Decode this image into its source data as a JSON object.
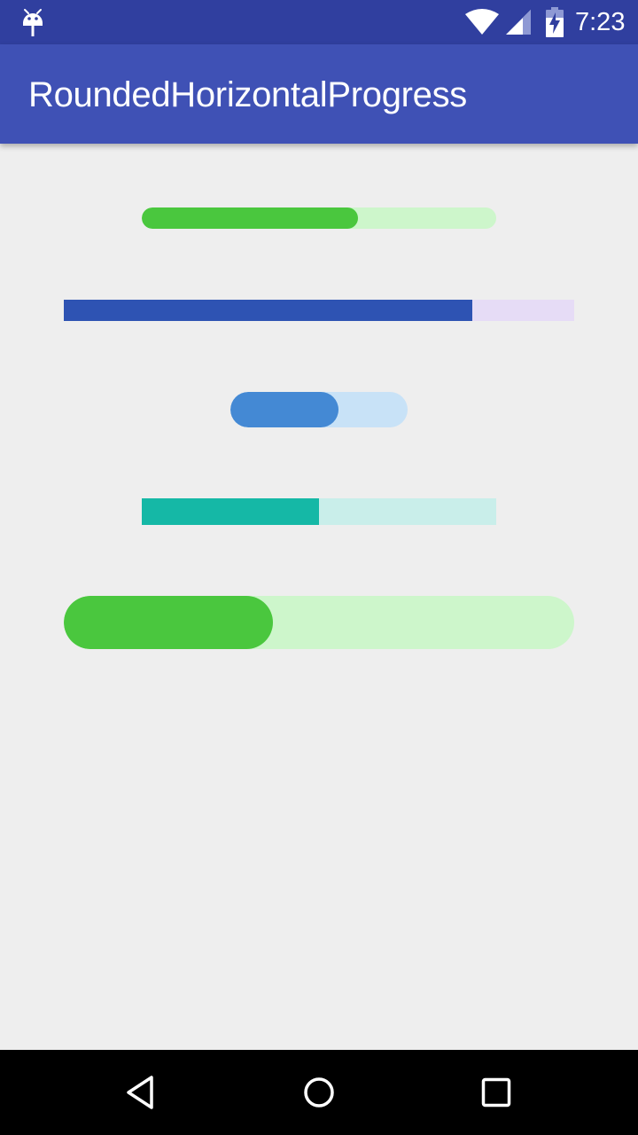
{
  "status_bar": {
    "time": "7:23",
    "icons": [
      "android-debug-icon",
      "wifi-icon",
      "signal-icon",
      "battery-charging-icon"
    ]
  },
  "app_bar": {
    "title": "RoundedHorizontalProgress"
  },
  "progress_bars": [
    {
      "name": "progress-rounded-small-green",
      "progress_percent": 61,
      "fill_color": "#4ac73e",
      "track_color": "#cdf6cb",
      "rounded": true
    },
    {
      "name": "progress-square-blue",
      "progress_percent": 80,
      "fill_color": "#2e53b3",
      "track_color": "#e6dcf6",
      "rounded": false
    },
    {
      "name": "progress-rounded-short-blue",
      "progress_percent": 61,
      "fill_color": "#4489d4",
      "track_color": "#c8e2f7",
      "rounded": true
    },
    {
      "name": "progress-square-teal",
      "progress_percent": 50,
      "fill_color": "#15b8a6",
      "track_color": "#c9eeea",
      "rounded": false
    },
    {
      "name": "progress-rounded-large-green",
      "progress_percent": 41,
      "fill_color": "#4ac73e",
      "track_color": "#cdf6cb",
      "rounded": true
    }
  ],
  "colors": {
    "status_bar": "#303f9f",
    "app_bar": "#3f51b5",
    "background": "#eeeeee",
    "nav_bar": "#000000"
  },
  "nav_bar": {
    "buttons": [
      "back-icon",
      "home-icon",
      "recents-icon"
    ]
  }
}
